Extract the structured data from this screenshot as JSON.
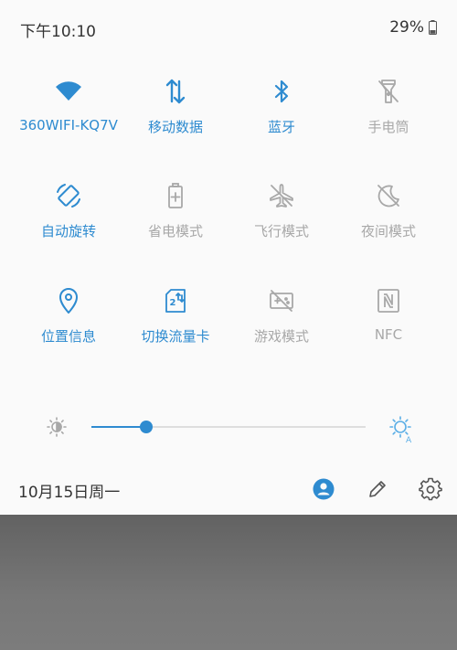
{
  "status_bar": {
    "time": "下午10:10",
    "battery": "29%"
  },
  "tiles": [
    {
      "label": "360WIFI-KQ7V",
      "icon": "wifi-icon",
      "active": true
    },
    {
      "label": "移动数据",
      "icon": "mobile-data-icon",
      "active": true
    },
    {
      "label": "蓝牙",
      "icon": "bluetooth-icon",
      "active": true
    },
    {
      "label": "手电筒",
      "icon": "flashlight-icon",
      "active": false
    },
    {
      "label": "自动旋转",
      "icon": "auto-rotate-icon",
      "active": true
    },
    {
      "label": "省电模式",
      "icon": "battery-saver-icon",
      "active": false
    },
    {
      "label": "飞行模式",
      "icon": "airplane-icon",
      "active": false
    },
    {
      "label": "夜间模式",
      "icon": "night-mode-icon",
      "active": false
    },
    {
      "label": "位置信息",
      "icon": "location-icon",
      "active": true
    },
    {
      "label": "切换流量卡",
      "icon": "sim-switch-icon",
      "active": true
    },
    {
      "label": "游戏模式",
      "icon": "game-mode-icon",
      "active": false
    },
    {
      "label": "NFC",
      "icon": "nfc-icon",
      "active": false
    }
  ],
  "brightness": {
    "level": 0.2
  },
  "footer": {
    "date": "10月15日周一"
  },
  "colors": {
    "accent": "#2e8bd0",
    "inactive": "#a8a8a8",
    "panel": "#fafafa"
  }
}
